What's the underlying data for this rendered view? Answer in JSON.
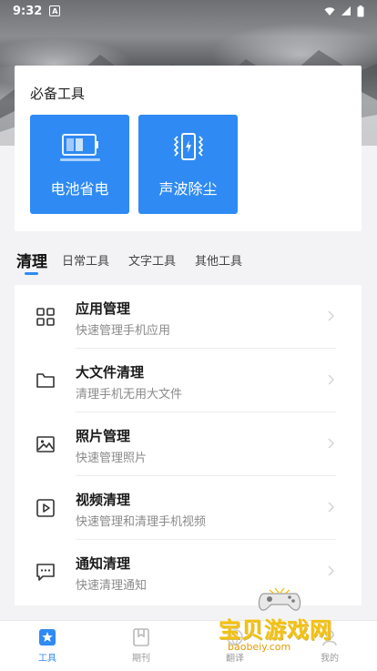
{
  "status_bar": {
    "time": "9:32",
    "notification_icon": "A"
  },
  "essentials": {
    "title": "必备工具",
    "tools": [
      {
        "label": "电池省电",
        "icon": "battery-icon"
      },
      {
        "label": "声波除尘",
        "icon": "phone-vibrate-icon"
      }
    ]
  },
  "tabs": [
    "清理",
    "日常工具",
    "文字工具",
    "其他工具"
  ],
  "list": [
    {
      "title": "应用管理",
      "subtitle": "快速管理手机应用",
      "icon": "apps-grid-icon"
    },
    {
      "title": "大文件清理",
      "subtitle": "清理手机无用大文件",
      "icon": "folder-icon"
    },
    {
      "title": "照片管理",
      "subtitle": "快速管理照片",
      "icon": "image-icon"
    },
    {
      "title": "视频清理",
      "subtitle": "快速管理和清理手机视频",
      "icon": "video-play-icon"
    },
    {
      "title": "通知清理",
      "subtitle": "快速清理通知",
      "icon": "message-icon"
    }
  ],
  "bottom_nav": [
    {
      "label": "工具",
      "active": true
    },
    {
      "label": "期刊",
      "active": false
    },
    {
      "label": "翻译",
      "active": false
    },
    {
      "label": "我的",
      "active": false
    }
  ],
  "watermark": {
    "text": "宝贝游戏网",
    "url": "baobeiy.com"
  },
  "colors": {
    "accent": "#2f8af3",
    "background": "#f3f3f5"
  }
}
